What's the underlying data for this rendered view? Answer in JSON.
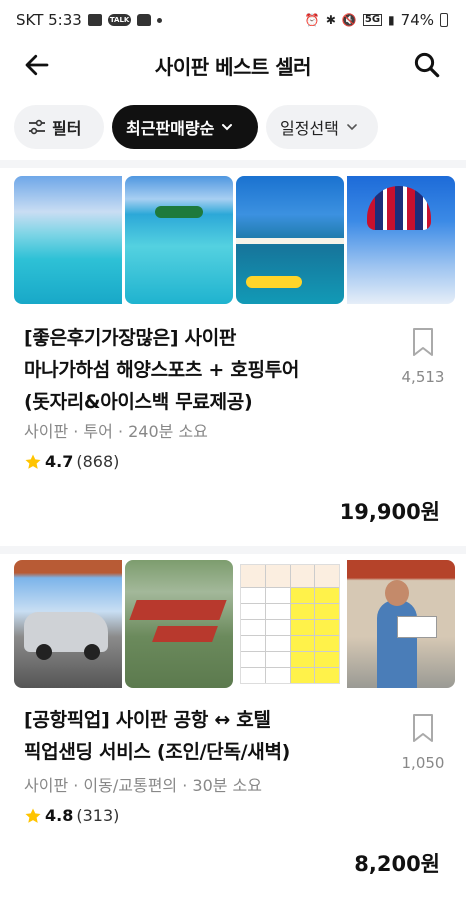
{
  "status_bar": {
    "carrier_time": "SKT 5:33",
    "battery": "74%"
  },
  "header": {
    "title": "사이판 베스트 셀러"
  },
  "filters": {
    "filter_label": "필터",
    "sort_label": "최근판매량순",
    "schedule_label": "일정선택"
  },
  "products": [
    {
      "title_line1": "[좋은후기가장많은] 사이판",
      "title_line2": "마나가하섬 해양스포츠 + 호핑투어",
      "title_line3": "(돗자리&아이스백 무료제공)",
      "meta": "사이판 · 투어 · 240분 소요",
      "rating": "4.7",
      "review_count": "(868)",
      "saves": "4,513",
      "price": "19,900원"
    },
    {
      "title_line1": "[공항픽업] 사이판 공항 ↔ 호텔",
      "title_line2": "픽업샌딩 서비스 (조인/단독/새벽)",
      "meta": "사이판 · 이동/교통편의 · 30분 소요",
      "rating": "4.8",
      "review_count": "(313)",
      "saves": "1,050",
      "price": "8,200원"
    }
  ],
  "colors": {
    "star": "#ffc400",
    "active_chip": "#111111",
    "chip_bg": "#f1f2f4"
  }
}
